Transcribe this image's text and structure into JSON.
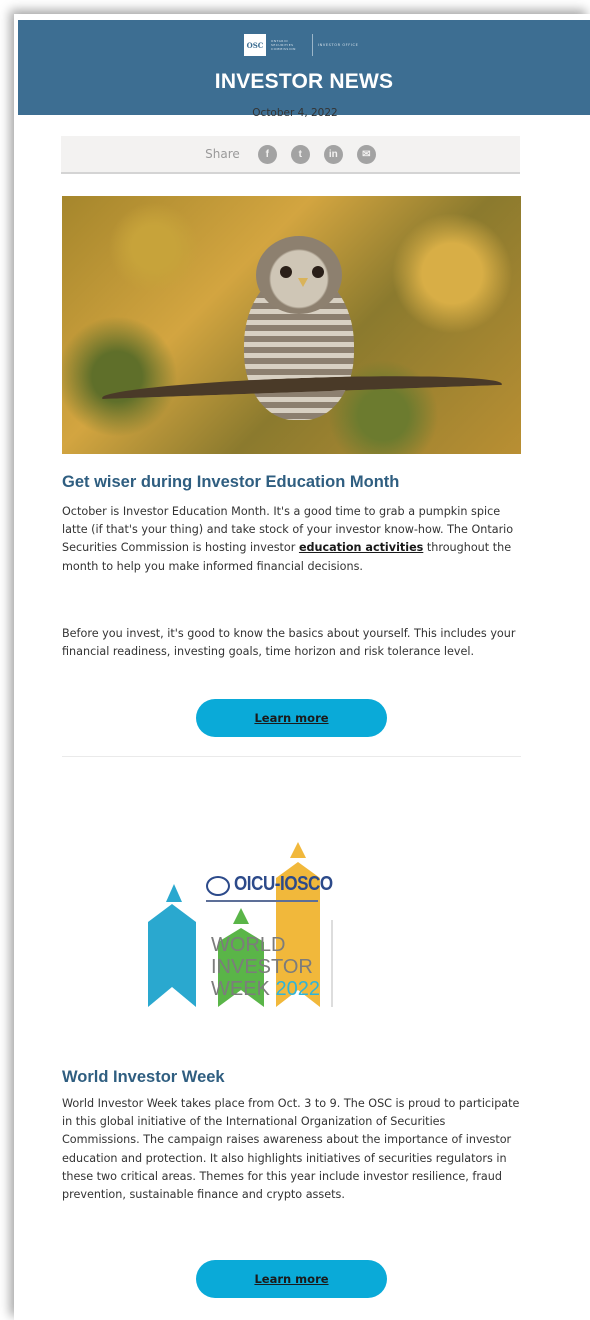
{
  "header": {
    "logo_abbr": "OSC",
    "logo_org": "ONTARIO SECURITIES COMMISSION",
    "logo_office": "INVESTOR OFFICE",
    "title": "INVESTOR NEWS"
  },
  "date": "October 4, 2022",
  "share": {
    "label": "Share",
    "icons": [
      {
        "name": "facebook-icon",
        "glyph": "f"
      },
      {
        "name": "twitter-icon",
        "glyph": "t"
      },
      {
        "name": "linkedin-icon",
        "glyph": "in"
      },
      {
        "name": "email-icon",
        "glyph": "✉"
      }
    ]
  },
  "article1": {
    "title": "Get wiser during Investor Education Month",
    "p1_before": "October is Investor Education Month. It's a good time to grab a pumpkin spice latte (if that's your thing) and take stock of your investor know-how. The Ontario Securities Commission is hosting investor ",
    "p1_link": "education activities",
    "p1_after": " throughout the month to help you make informed financial decisions.",
    "p2": "Before you invest, it's good to know the basics about yourself. This includes your financial readiness, investing goals, time horizon and risk tolerance level.",
    "button": "Learn more"
  },
  "logo2": {
    "org": "OICU-IOSCO",
    "line1": "WORLD",
    "line2": "INVESTOR",
    "line3": "WEEK",
    "year": "2022"
  },
  "article2": {
    "title": "World Investor Week",
    "body": "World Investor Week takes place from Oct. 3 to 9. The OSC is proud to participate in this global initiative of the International Organization of Securities Commissions. The campaign raises awareness about the importance of investor education and protection. It also highlights initiatives of securities regulators in these two critical areas. Themes for this year include investor resilience, fraud prevention, sustainable finance and crypto assets.",
    "button": "Learn more"
  }
}
